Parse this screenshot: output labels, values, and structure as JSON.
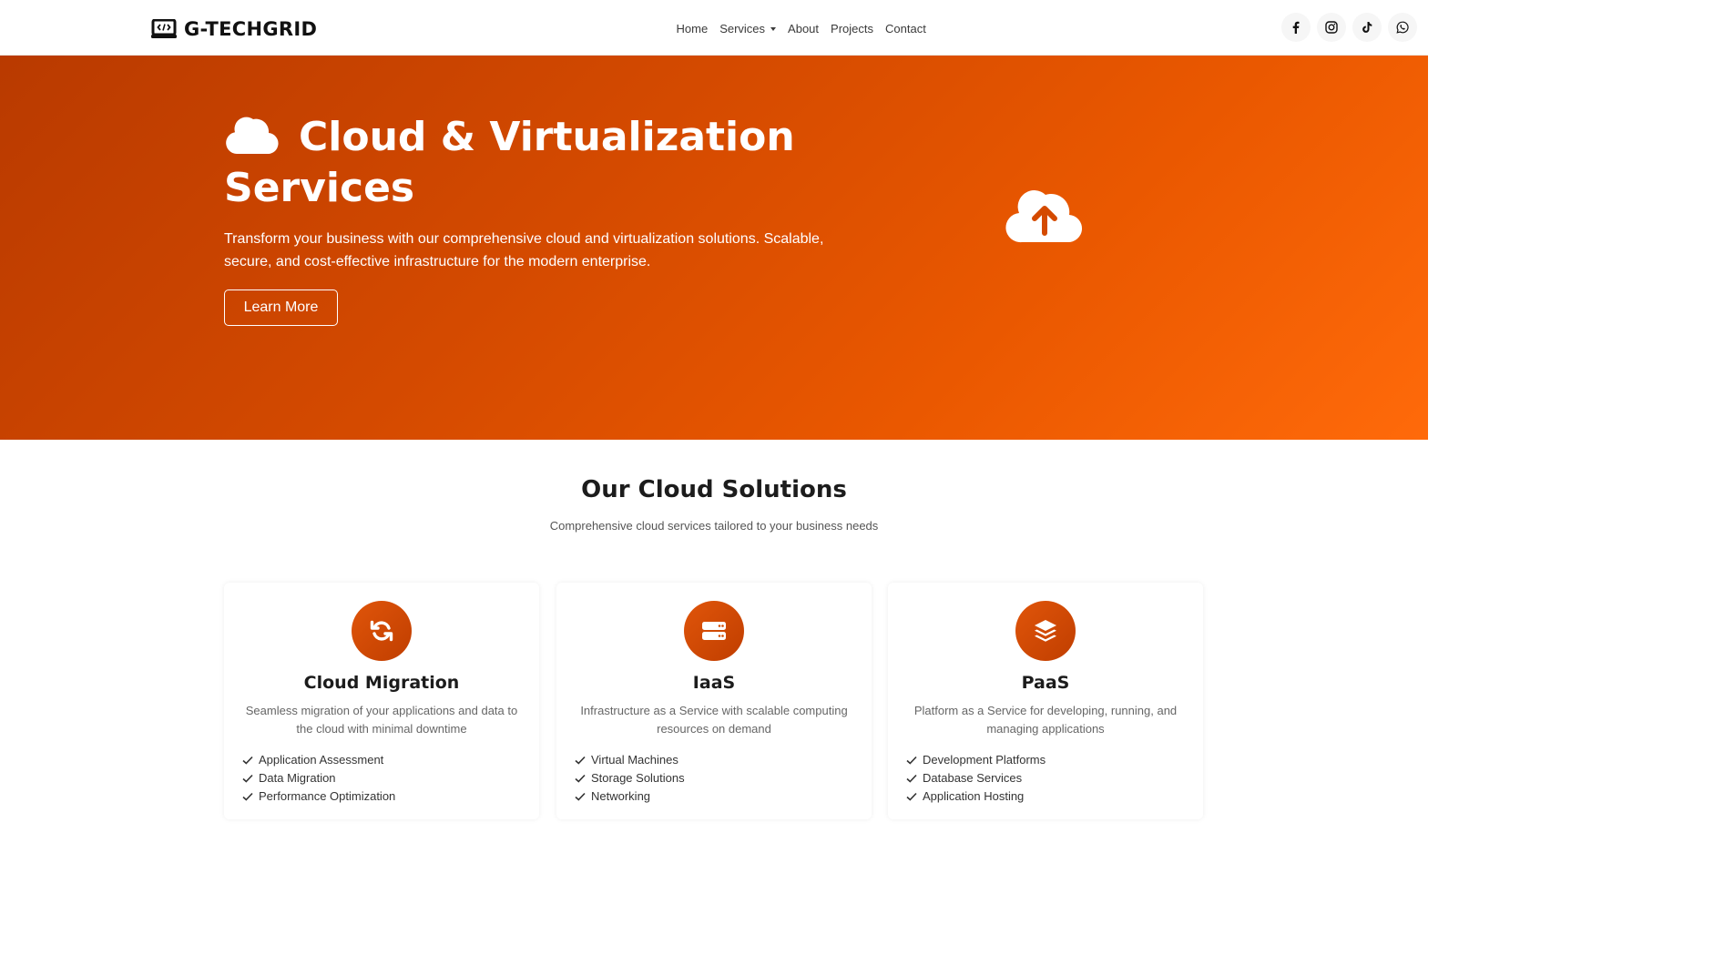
{
  "brand": {
    "name": "G-TECHGRID"
  },
  "nav": {
    "items": [
      {
        "label": "Home"
      },
      {
        "label": "Services"
      },
      {
        "label": "About"
      },
      {
        "label": "Projects"
      },
      {
        "label": "Contact"
      }
    ]
  },
  "socials": [
    {
      "icon": "facebook-icon"
    },
    {
      "icon": "instagram-icon"
    },
    {
      "icon": "tiktok-icon"
    },
    {
      "icon": "whatsapp-icon"
    }
  ],
  "hero": {
    "title": "Cloud & Virtualization Services",
    "description": "Transform your business with our comprehensive cloud and virtualization solutions. Scalable, secure, and cost-effective infrastructure for the modern enterprise.",
    "button_label": "Learn More",
    "gradient_start": "#b93a00",
    "gradient_end": "#ff6a0a"
  },
  "solutions": {
    "title": "Our Cloud Solutions",
    "subtitle": "Comprehensive cloud services tailored to your business needs",
    "cards": [
      {
        "icon": "sync-icon",
        "title": "Cloud Migration",
        "description": "Seamless migration of your applications and data to the cloud with minimal downtime",
        "features": [
          "Application Assessment",
          "Data Migration",
          "Performance Optimization"
        ]
      },
      {
        "icon": "server-icon",
        "title": "IaaS",
        "description": "Infrastructure as a Service with scalable computing resources on demand",
        "features": [
          "Virtual Machines",
          "Storage Solutions",
          "Networking"
        ]
      },
      {
        "icon": "layers-icon",
        "title": "PaaS",
        "description": "Platform as a Service for developing, running, and managing applications",
        "features": [
          "Development Platforms",
          "Database Services",
          "Application Hosting"
        ]
      }
    ]
  },
  "colors": {
    "accent": "#d94c04",
    "text_dark": "#1c1c1c"
  }
}
